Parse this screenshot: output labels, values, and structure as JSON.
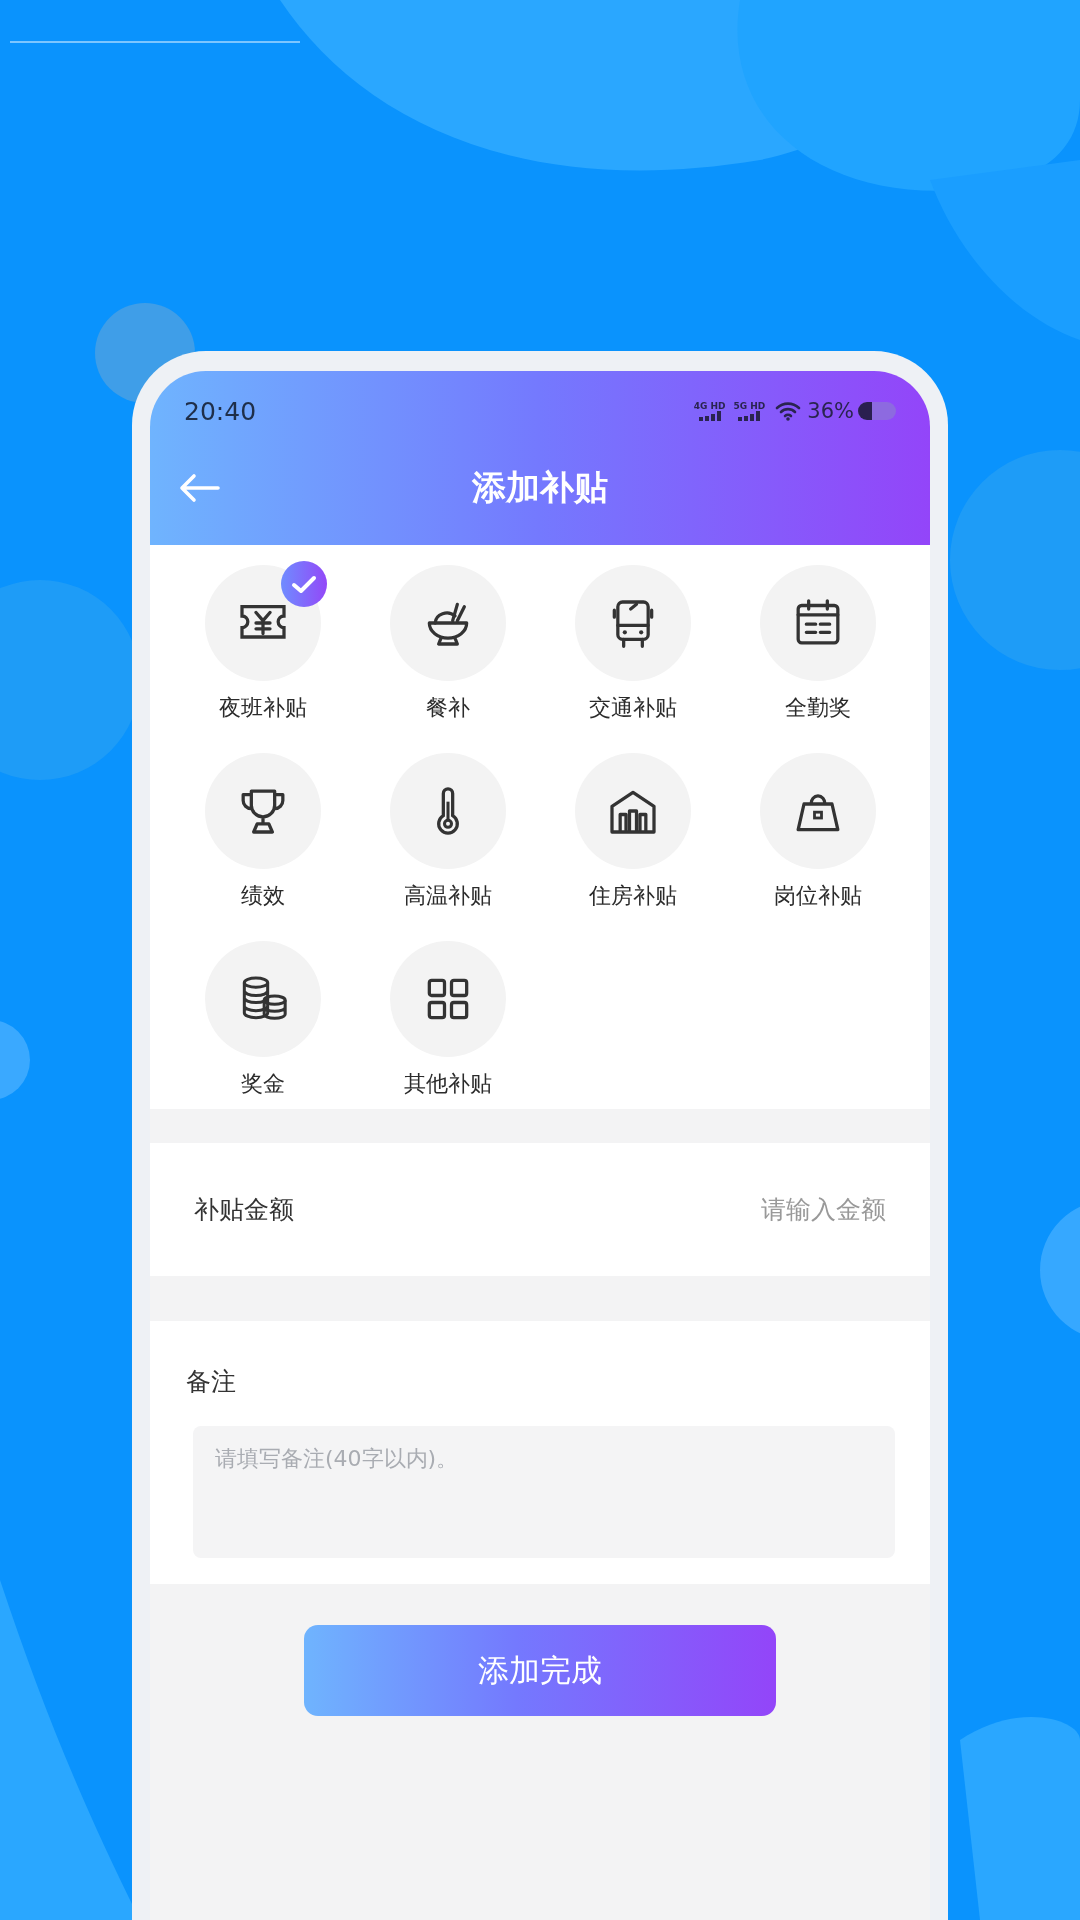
{
  "status_bar": {
    "time": "20:40",
    "network_1": "4G HD",
    "network_2": "5G HD",
    "battery": "36%"
  },
  "header": {
    "title": "添加补贴"
  },
  "categories": [
    {
      "label": "夜班补贴",
      "selected": true
    },
    {
      "label": "餐补",
      "selected": false
    },
    {
      "label": "交通补贴",
      "selected": false
    },
    {
      "label": "全勤奖",
      "selected": false
    },
    {
      "label": "绩效",
      "selected": false
    },
    {
      "label": "高温补贴",
      "selected": false
    },
    {
      "label": "住房补贴",
      "selected": false
    },
    {
      "label": "岗位补贴",
      "selected": false
    },
    {
      "label": "奖金",
      "selected": false
    },
    {
      "label": "其他补贴",
      "selected": false
    }
  ],
  "amount": {
    "label": "补贴金额",
    "placeholder": "请输入金额"
  },
  "remark": {
    "label": "备注",
    "placeholder": "请填写备注(40字以内)。"
  },
  "submit_button": "添加完成"
}
